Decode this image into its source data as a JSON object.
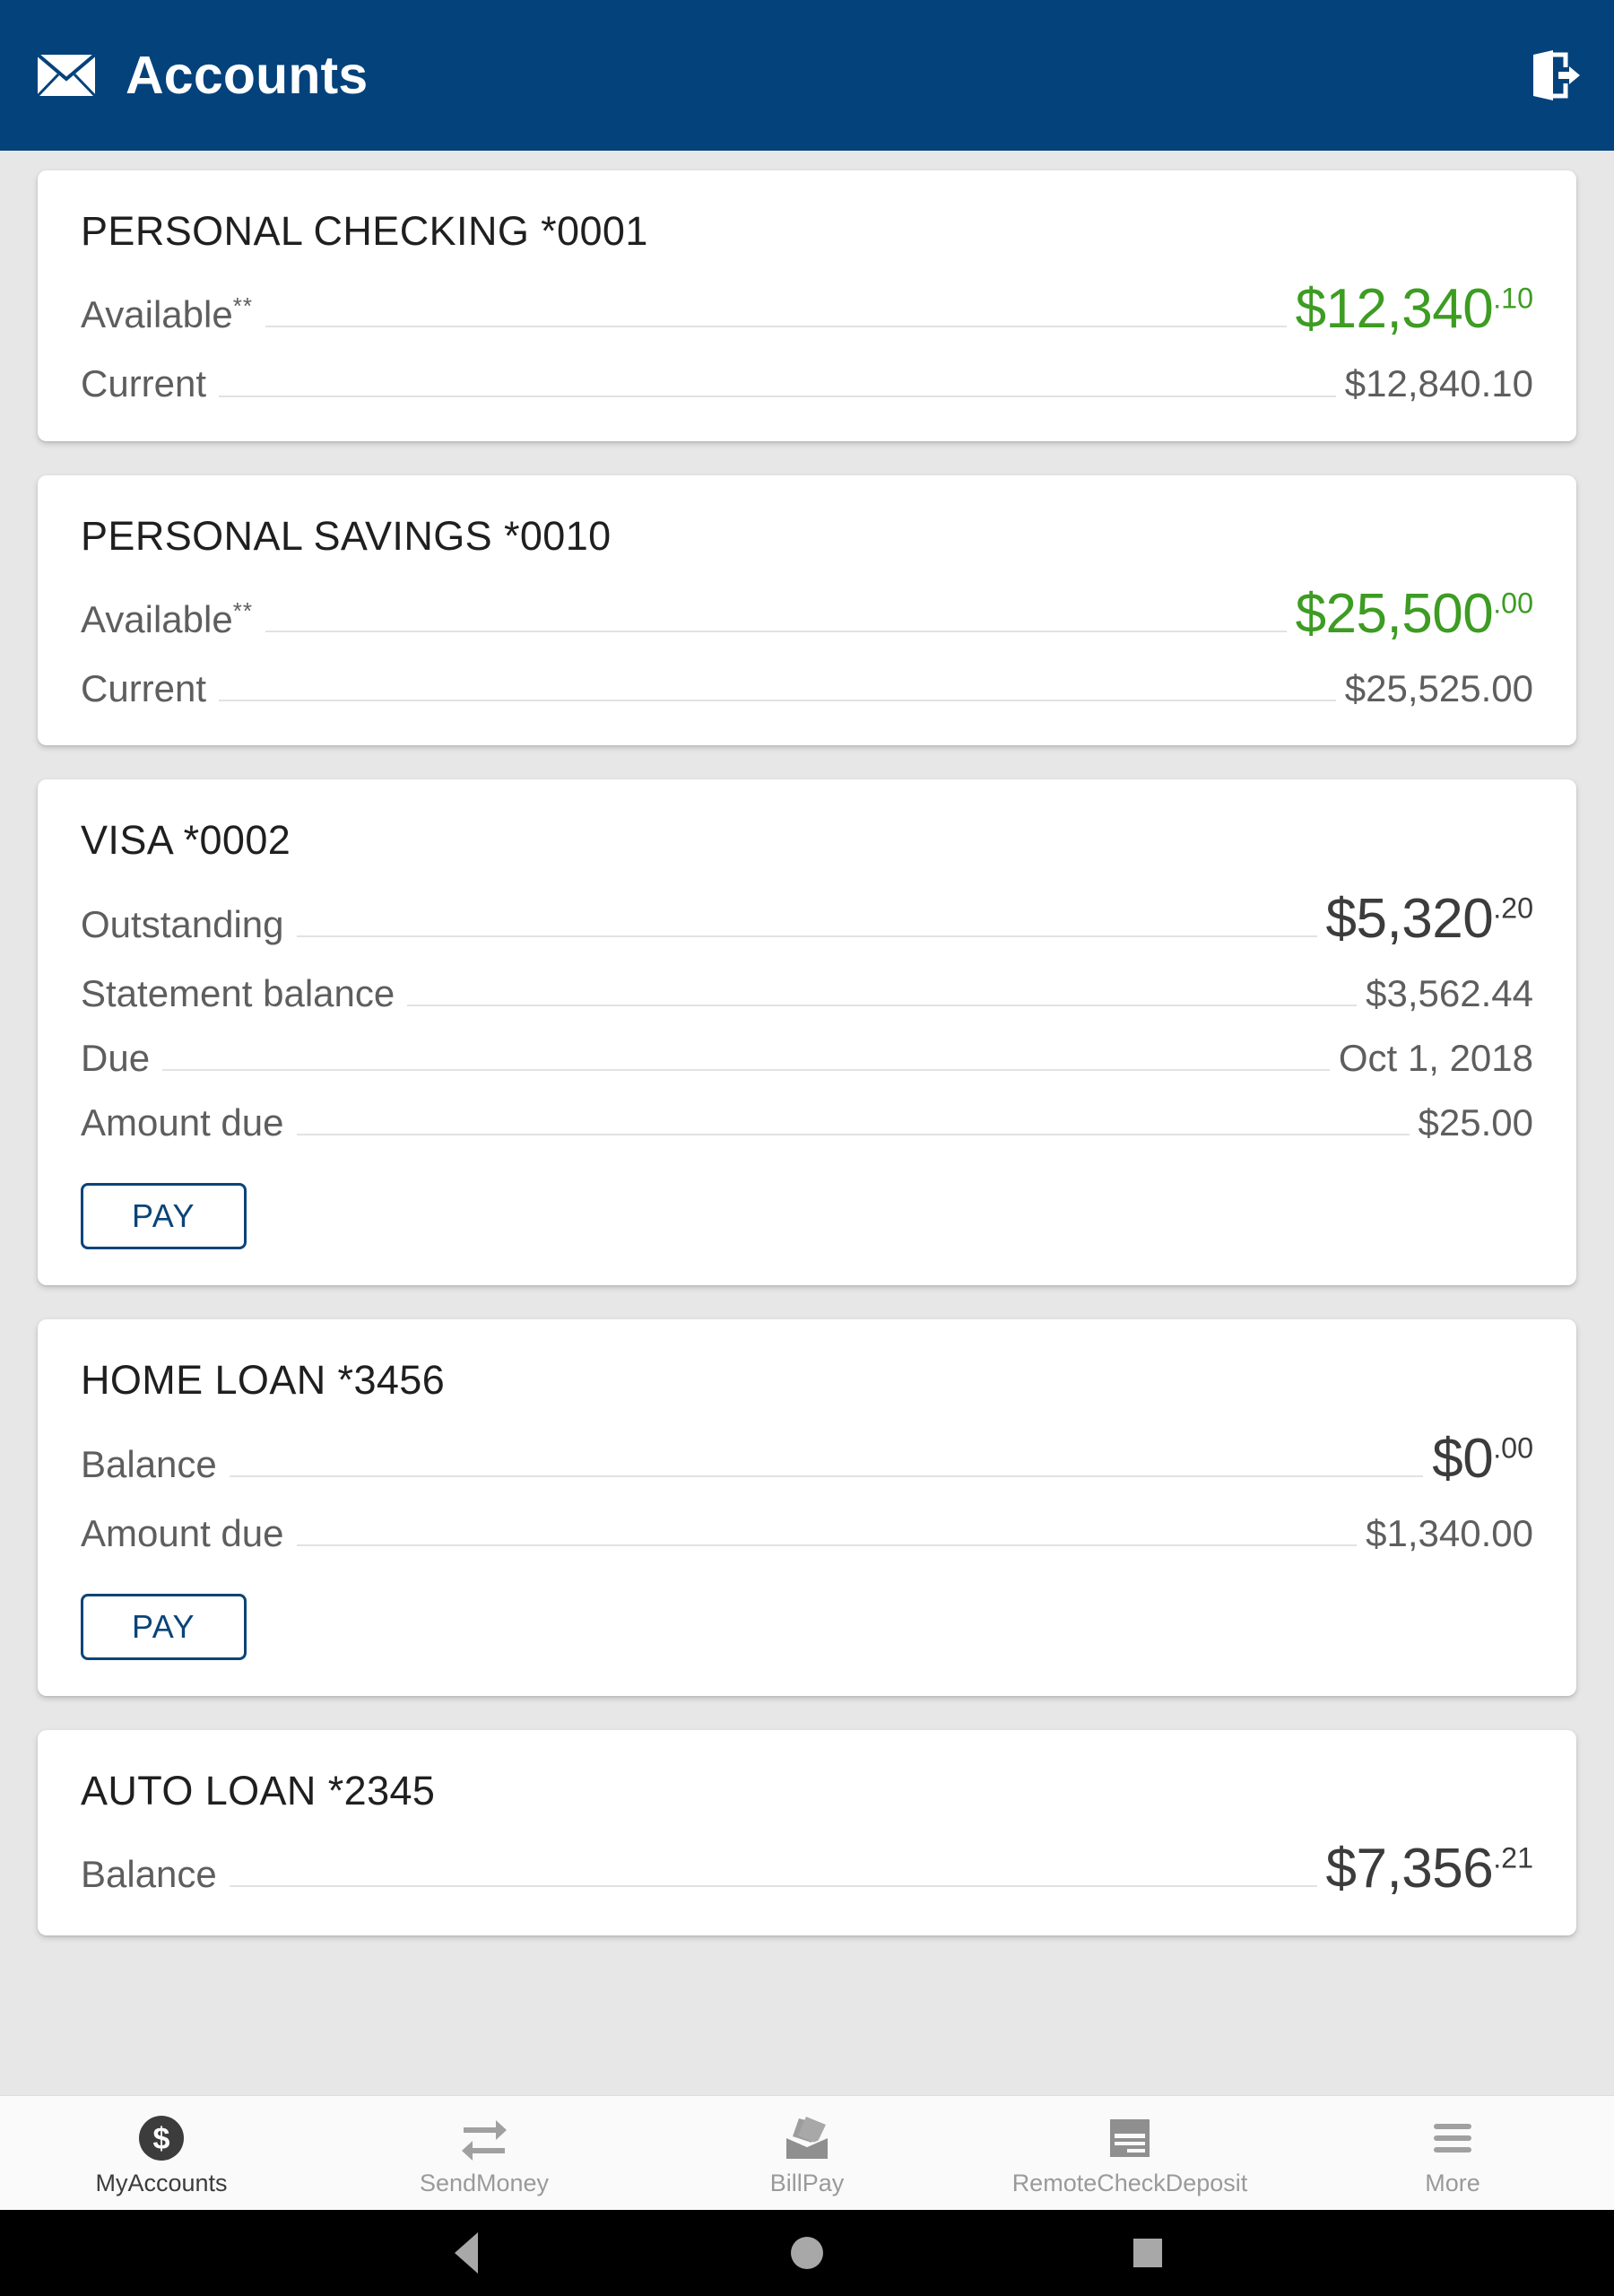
{
  "appbar": {
    "title": "Accounts",
    "mail_icon": "mail-icon",
    "logout_icon": "logout-icon"
  },
  "accounts": [
    {
      "title": "PERSONAL CHECKING *0001",
      "rows": [
        {
          "label": "Available",
          "sup": "**",
          "primary": true,
          "green": true,
          "dollars": "$12,340",
          "cents": ".10"
        },
        {
          "label": "Current",
          "sup": "",
          "primary": false,
          "green": false,
          "value": "$12,840.10"
        }
      ],
      "pay_label": "",
      "has_pay": false
    },
    {
      "title": "PERSONAL SAVINGS *0010",
      "rows": [
        {
          "label": "Available",
          "sup": "**",
          "primary": true,
          "green": true,
          "dollars": "$25,500",
          "cents": ".00"
        },
        {
          "label": "Current",
          "sup": "",
          "primary": false,
          "green": false,
          "value": "$25,525.00"
        }
      ],
      "pay_label": "",
      "has_pay": false
    },
    {
      "title": "VISA *0002",
      "rows": [
        {
          "label": "Outstanding",
          "sup": "",
          "primary": true,
          "green": false,
          "dollars": "$5,320",
          "cents": ".20"
        },
        {
          "label": "Statement balance",
          "sup": "",
          "primary": false,
          "green": false,
          "value": "$3,562.44"
        },
        {
          "label": "Due",
          "sup": "",
          "primary": false,
          "green": false,
          "value": "Oct 1, 2018"
        },
        {
          "label": "Amount due",
          "sup": "",
          "primary": false,
          "green": false,
          "value": "$25.00"
        }
      ],
      "pay_label": "PAY",
      "has_pay": true
    },
    {
      "title": "HOME LOAN *3456",
      "rows": [
        {
          "label": "Balance",
          "sup": "",
          "primary": true,
          "green": false,
          "dollars": "$0",
          "cents": ".00"
        },
        {
          "label": "Amount due",
          "sup": "",
          "primary": false,
          "green": false,
          "value": "$1,340.00"
        }
      ],
      "pay_label": "PAY",
      "has_pay": true
    },
    {
      "title": "AUTO LOAN *2345",
      "rows": [
        {
          "label": "Balance",
          "sup": "",
          "primary": true,
          "green": false,
          "dollars": "$7,356",
          "cents": ".21"
        }
      ],
      "pay_label": "",
      "has_pay": false
    }
  ],
  "bottomnav": {
    "items": [
      {
        "label": "MyAccounts",
        "icon": "dollar-circle-icon",
        "active": true
      },
      {
        "label": "SendMoney",
        "icon": "transfer-arrows-icon",
        "active": false
      },
      {
        "label": "BillPay",
        "icon": "envelope-bills-icon",
        "active": false
      },
      {
        "label": "RemoteCheckDeposit",
        "icon": "check-card-icon",
        "active": false
      },
      {
        "label": "More",
        "icon": "hamburger-menu-icon",
        "active": false
      }
    ]
  },
  "systembar": {
    "back": "back-triangle-icon",
    "home": "home-circle-icon",
    "recents": "recents-square-icon"
  },
  "colors": {
    "appbar": "#04427c",
    "accent_navy": "#0b4478",
    "positive_green": "#3d9c22",
    "page_bg": "#e7e7e7",
    "card_bg": "#ffffff",
    "label_gray": "#5e5e5e",
    "value_gray": "#5e5e5e",
    "nav_inactive": "#9a9a9a",
    "nav_active": "#3c3c3c"
  }
}
